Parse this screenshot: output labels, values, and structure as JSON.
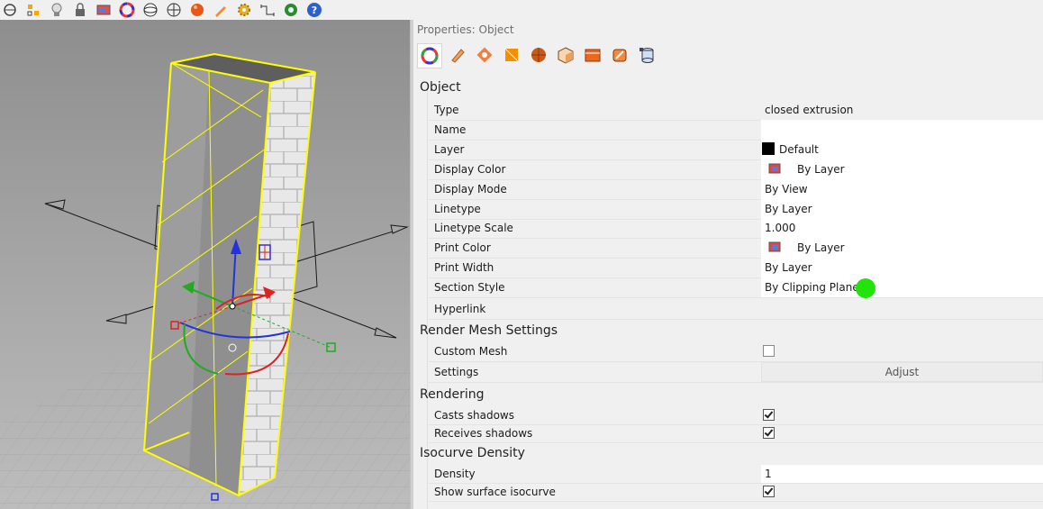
{
  "toolbar": {
    "icons": [
      "pan-icon",
      "points-icon",
      "lightbulb-icon",
      "lock-icon",
      "layer-icon",
      "color-wheel-icon",
      "sphere-wire-icon",
      "grid-sphere-icon",
      "render-sphere-icon",
      "pencil-icon",
      "gear-icon",
      "dimension-icon",
      "globe-icon",
      "help-icon"
    ]
  },
  "viewport": {
    "name": "Perspective viewport",
    "background": "#a7a7a7",
    "selection_color": "#ffff00"
  },
  "panel": {
    "title": "Properties: Object",
    "tabs": [
      "object-color-icon",
      "material-pencil-icon",
      "decal-icon",
      "texture-icon",
      "render-sphere-icon",
      "box-mapping-icon",
      "section-style-icon",
      "render-box-icon",
      "layer-stack-icon"
    ],
    "sections": {
      "object": {
        "title": "Object",
        "rows": [
          {
            "label": "Type",
            "value": "closed extrusion"
          },
          {
            "label": "Name",
            "value": ""
          },
          {
            "label": "Layer",
            "value": "Default"
          },
          {
            "label": "Display Color",
            "value": "By Layer"
          },
          {
            "label": "Display Mode",
            "value": "By View"
          },
          {
            "label": "Linetype",
            "value": "By Layer"
          },
          {
            "label": "Linetype Scale",
            "value": "1.000"
          },
          {
            "label": "Print Color",
            "value": "By Layer"
          },
          {
            "label": "Print Width",
            "value": "By Layer"
          },
          {
            "label": "Section Style",
            "value": "By Clipping Plane"
          },
          {
            "label": "Hyperlink",
            "value": ""
          }
        ]
      },
      "render_mesh": {
        "title": "Render Mesh Settings",
        "custom_mesh_label": "Custom Mesh",
        "settings_label": "Settings",
        "adjust_label": "Adjust"
      },
      "rendering": {
        "title": "Rendering",
        "casts_label": "Casts shadows",
        "receives_label": "Receives shadows"
      },
      "isocurve": {
        "title": "Isocurve Density",
        "density_label": "Density",
        "density_value": "1",
        "show_label": "Show surface isocurve"
      }
    }
  },
  "colors": {
    "accent_green": "#22e30a",
    "layer_swatch": "#000000"
  }
}
